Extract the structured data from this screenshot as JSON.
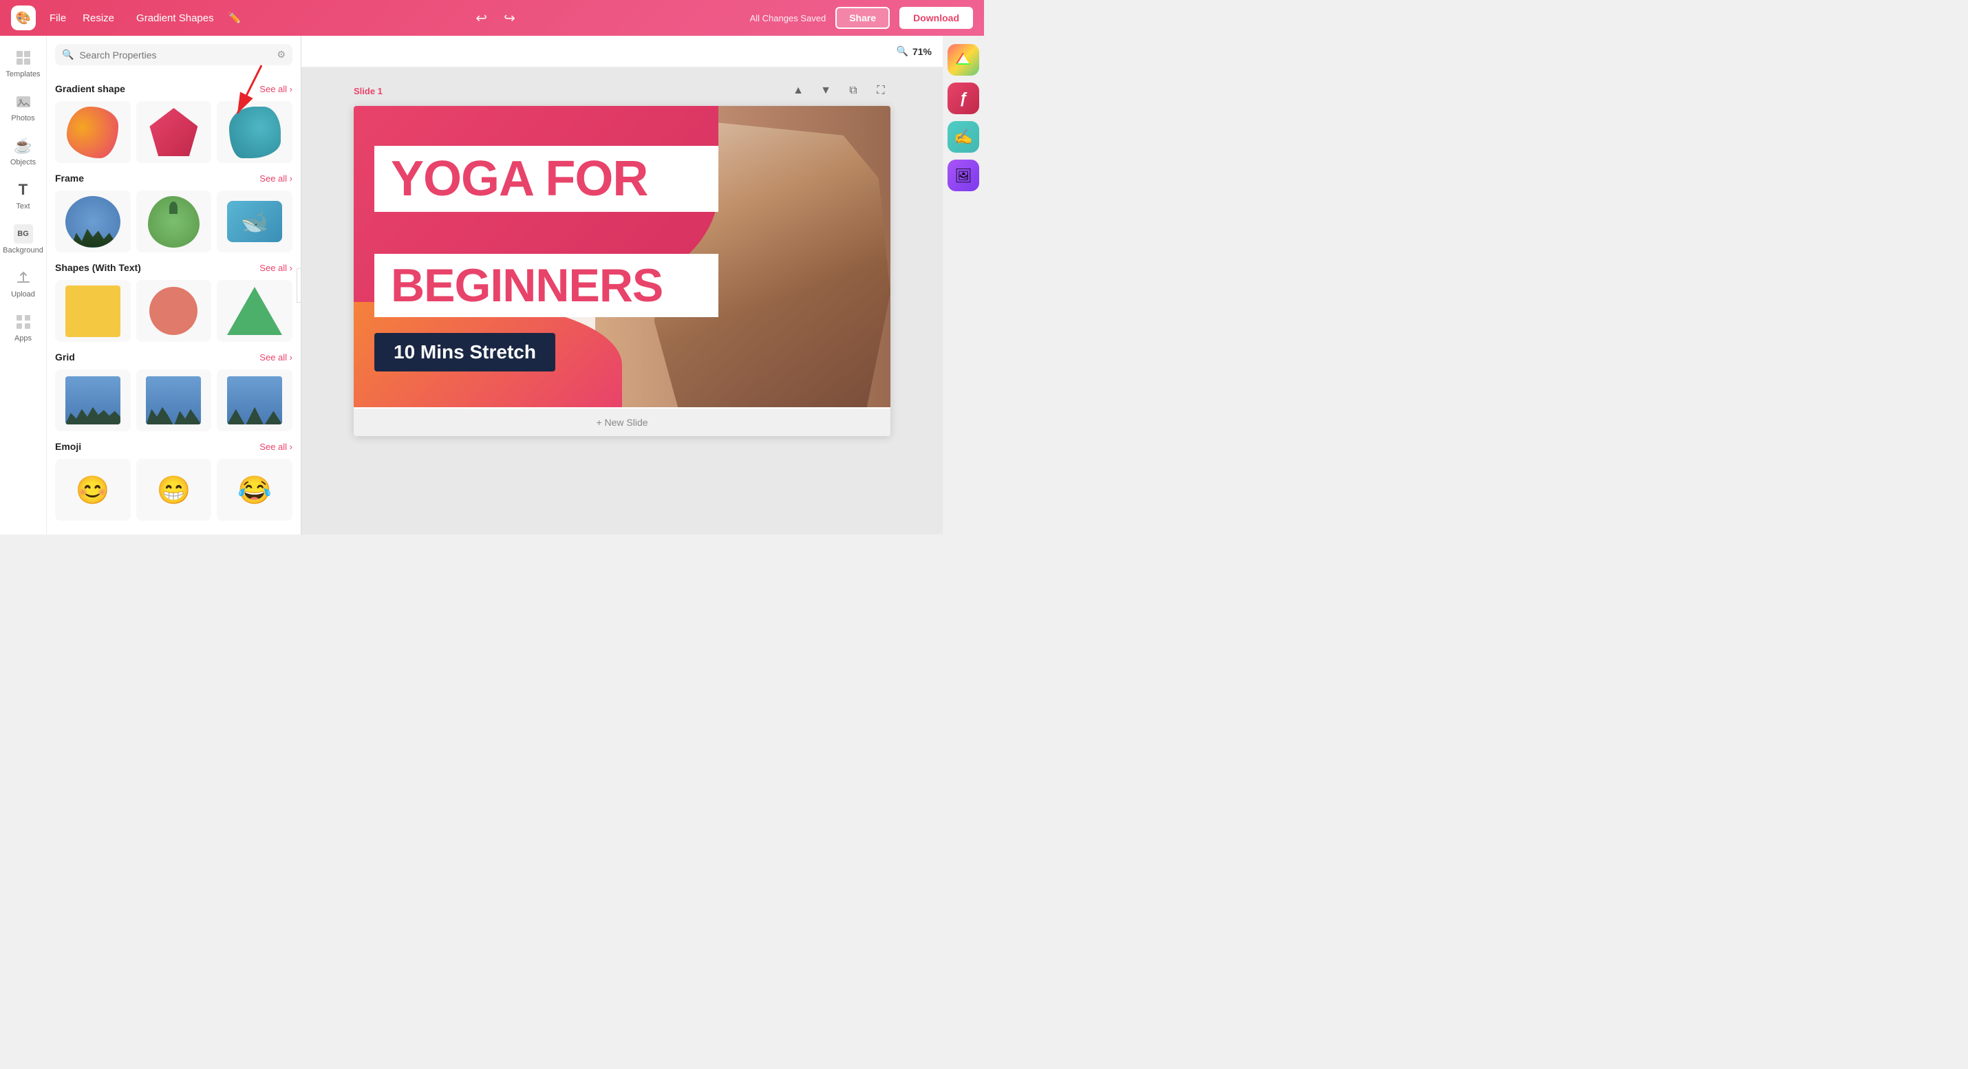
{
  "topbar": {
    "logo_icon": "🎨",
    "menu": {
      "file": "File",
      "resize": "Resize",
      "title": "Gradient Shapes"
    },
    "saved_text": "All Changes Saved",
    "share_label": "Share",
    "download_label": "Download"
  },
  "sidebar_icons": [
    {
      "id": "templates",
      "icon": "⊞",
      "label": "Templates"
    },
    {
      "id": "photos",
      "icon": "🖼",
      "label": "Photos"
    },
    {
      "id": "objects",
      "icon": "☕",
      "label": "Objects"
    },
    {
      "id": "text",
      "icon": "T",
      "label": "Text"
    },
    {
      "id": "background",
      "icon": "BG",
      "label": "Background"
    },
    {
      "id": "upload",
      "icon": "↑",
      "label": "Upload"
    },
    {
      "id": "apps",
      "icon": "⊞",
      "label": "Apps"
    }
  ],
  "properties_panel": {
    "search_placeholder": "Search Properties",
    "sections": [
      {
        "id": "gradient-shape",
        "title": "Gradient shape",
        "see_all": "See all"
      },
      {
        "id": "frame",
        "title": "Frame",
        "see_all": "See all"
      },
      {
        "id": "shapes-with-text",
        "title": "Shapes (With Text)",
        "see_all": "See all"
      },
      {
        "id": "grid",
        "title": "Grid",
        "see_all": "See all"
      },
      {
        "id": "emoji",
        "title": "Emoji",
        "see_all": "See all"
      }
    ]
  },
  "canvas": {
    "zoom_level": "71%",
    "slide_label": "Slide 1",
    "new_slide_text": "+ New Slide"
  },
  "slide": {
    "title_line1": "YOGA FOR",
    "title_line2": "BEGINNERS",
    "subtitle": "10 Mins Stretch"
  },
  "right_apps": [
    {
      "id": "app1",
      "label": "gradient-app"
    },
    {
      "id": "app2",
      "label": "font-app"
    },
    {
      "id": "app3",
      "label": "paint-app"
    },
    {
      "id": "app4",
      "label": "photo-app"
    }
  ]
}
